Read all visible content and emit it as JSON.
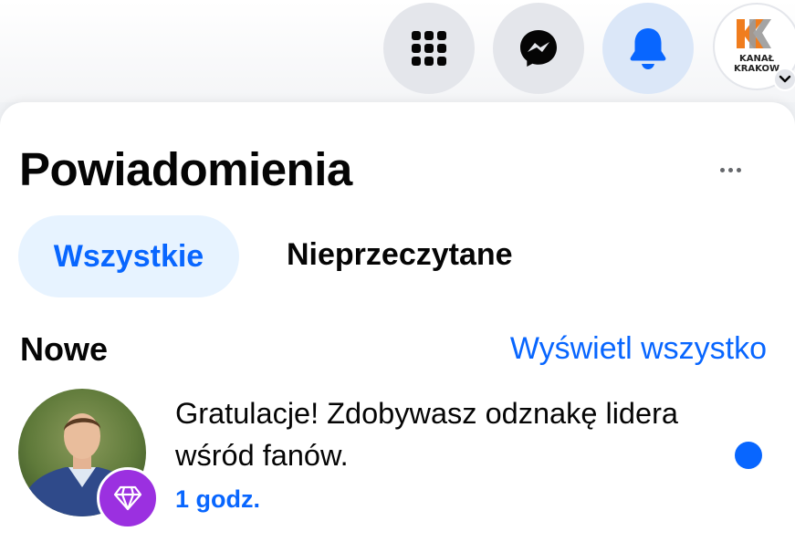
{
  "topbar": {
    "menu_icon": "grid-menu-icon",
    "messenger_icon": "messenger-icon",
    "notifications_icon": "bell-icon",
    "profile": {
      "logo_text": "KANAŁ\nKRAKOW",
      "caret_icon": "chevron-down-icon"
    }
  },
  "panel": {
    "title": "Powiadomienia",
    "more_icon": "more-horizontal-icon",
    "tabs": [
      {
        "label": "Wszystkie",
        "selected": true
      },
      {
        "label": "Nieprzeczytane",
        "selected": false
      }
    ],
    "section": {
      "title": "Nowe",
      "see_all": "Wyświetl wszystko"
    },
    "notifications": [
      {
        "text": "Gratulacje! Zdobywasz odznakę lidera wśród fanów.",
        "time": "1 godz.",
        "badge_icon": "diamond-icon",
        "unread": true
      }
    ]
  },
  "colors": {
    "accent": "#0866ff",
    "tab_selected_bg": "#e7f3ff",
    "badge_bg": "#9b30e0",
    "logo_orange": "#f07d1e",
    "logo_gray": "#9a9a9a",
    "button_bg": "#e4e6eb"
  }
}
